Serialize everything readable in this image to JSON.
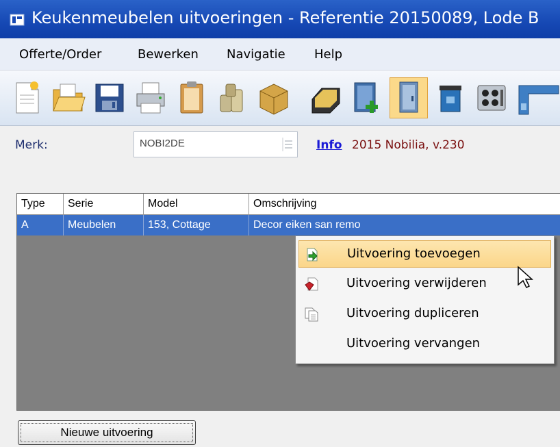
{
  "window": {
    "title": "Keukenmeubelen uitvoeringen - Referentie 20150089, Lode B"
  },
  "menu": [
    "Offerte/Order",
    "Bewerken",
    "Navigatie",
    "Help"
  ],
  "toolbar": {
    "buttons": [
      "new-document-icon",
      "open-folder-icon",
      "save-icon",
      "print-icon",
      "clipboard-icon",
      "coins-icon",
      "box-icon",
      "register-icon",
      "add-cabinet-icon",
      "door-icon",
      "bin-icon",
      "hob-icon",
      "worktop-icon"
    ],
    "active": "door-icon"
  },
  "merk": {
    "label": "Merk:",
    "value": "NOBI2DE",
    "info_link": "Info",
    "info_text": "2015 Nobilia, v.230"
  },
  "table": {
    "columns": [
      "Type",
      "Serie",
      "Model",
      "Omschrijving"
    ],
    "rows": [
      {
        "type": "A",
        "serie": "Meubelen",
        "model": "153, Cottage",
        "omschrijving": "Decor eiken san remo"
      }
    ]
  },
  "context_menu": {
    "items": [
      {
        "label": "Uitvoering toevoegen",
        "icon": "add-arrow-icon",
        "highlighted": true
      },
      {
        "label": "Uitvoering verwijderen",
        "icon": "delete-icon",
        "highlighted": false
      },
      {
        "label": "Uitvoering dupliceren",
        "icon": "duplicate-icon",
        "highlighted": false
      },
      {
        "label": "Uitvoering vervangen",
        "icon": "",
        "highlighted": false
      }
    ]
  },
  "footer": {
    "new_button": "Nieuwe uitvoering"
  },
  "colors": {
    "titlebar": "#1648b4",
    "selection": "#3a6fc7",
    "highlight": "#fbd68a"
  }
}
